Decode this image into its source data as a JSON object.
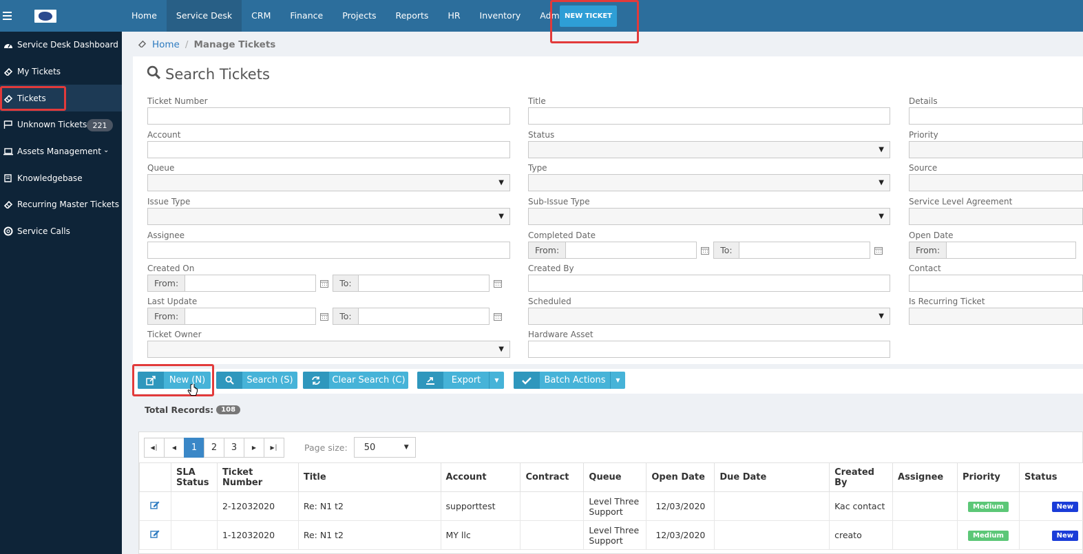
{
  "topnav": {
    "items": [
      "Home",
      "Service Desk",
      "CRM",
      "Finance",
      "Projects",
      "Reports",
      "HR",
      "Inventory",
      "Admin"
    ],
    "active_index": 1,
    "new_ticket_label": "NEW TICKET"
  },
  "sidebar": {
    "items": [
      {
        "label": "Service Desk Dashboard",
        "icon": "dashboard-icon"
      },
      {
        "label": "My Tickets",
        "icon": "ticket-icon"
      },
      {
        "label": "Tickets",
        "icon": "ticket-icon"
      },
      {
        "label": "Unknown Tickets",
        "icon": "flag-icon",
        "badge": "221"
      },
      {
        "label": "Assets Management",
        "icon": "laptop-icon"
      },
      {
        "label": "Knowledgebase",
        "icon": "book-icon"
      },
      {
        "label": "Recurring Master Tickets",
        "icon": "ticket-icon"
      },
      {
        "label": "Service Calls",
        "icon": "lifebuoy-icon"
      }
    ],
    "active_index": 2
  },
  "breadcrumb": {
    "home": "Home",
    "current": "Manage Tickets"
  },
  "search": {
    "title": "Search Tickets",
    "labels": {
      "ticket_number": "Ticket Number",
      "title": "Title",
      "details": "Details",
      "account": "Account",
      "status": "Status",
      "priority": "Priority",
      "queue": "Queue",
      "type": "Type",
      "source": "Source",
      "issue_type": "Issue Type",
      "sub_issue_type": "Sub-Issue Type",
      "sla": "Service Level Agreement",
      "assignee": "Assignee",
      "completed_date": "Completed Date",
      "open_date": "Open Date",
      "created_on": "Created On",
      "created_by": "Created By",
      "contact": "Contact",
      "last_update": "Last Update",
      "scheduled": "Scheduled",
      "is_recurring": "Is Recurring Ticket",
      "ticket_owner": "Ticket Owner",
      "hardware_asset": "Hardware Asset"
    },
    "from_label": "From:",
    "to_label": "To:"
  },
  "actions": {
    "new": "New (N)",
    "search": "Search (S)",
    "clear": "Clear Search (C)",
    "export": "Export",
    "batch": "Batch Actions"
  },
  "total": {
    "label": "Total Records:",
    "count": "108"
  },
  "pager": {
    "pages": [
      "1",
      "2",
      "3"
    ],
    "current": "1",
    "size_label": "Page size:",
    "size_value": "50"
  },
  "table": {
    "columns": [
      "",
      "SLA Status",
      "Ticket Number",
      "Title",
      "Account",
      "Contract",
      "Queue",
      "Open Date",
      "Due Date",
      "Created By",
      "Assignee",
      "Priority",
      "Status"
    ],
    "rows": [
      {
        "sla": "",
        "number": "2-12032020",
        "title": "Re: N1 t2",
        "account": "supporttest",
        "contract": "",
        "queue": "Level Three Support",
        "open_date": "12/03/2020",
        "due_date": "",
        "created_by": "Kac contact",
        "assignee": "",
        "priority": "Medium",
        "status": "New"
      },
      {
        "sla": "",
        "number": "1-12032020",
        "title": "Re: N1 t2",
        "account": "MY llc",
        "contract": "",
        "queue": "Level Three Support",
        "open_date": "12/03/2020",
        "due_date": "",
        "created_by": "creato",
        "assignee": "",
        "priority": "Medium",
        "status": "New"
      }
    ]
  }
}
